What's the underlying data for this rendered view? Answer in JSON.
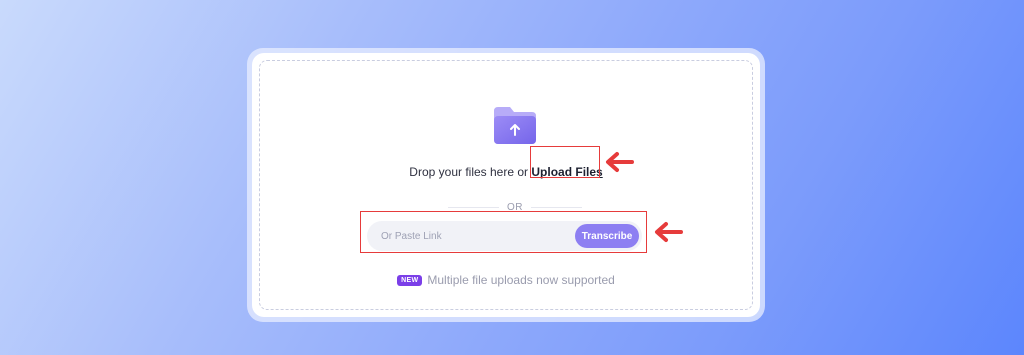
{
  "upload": {
    "drop_prompt": "Drop your files here or ",
    "upload_link": "Upload Files",
    "divider_text": "OR"
  },
  "link_form": {
    "placeholder": "Or Paste Link",
    "transcribe_label": "Transcribe"
  },
  "notice": {
    "badge": "NEW",
    "text": "Multiple file uploads now supported"
  },
  "colors": {
    "accent": "#8d7ff2",
    "badge": "#7b3fe8",
    "annotation": "#e63b3b"
  },
  "icons": [
    "folder-upload-icon",
    "arrow-left-icon"
  ]
}
